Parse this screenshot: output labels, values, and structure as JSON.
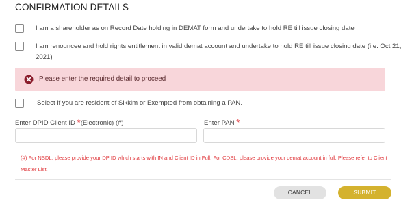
{
  "section": {
    "title": "CONFIRMATION DETAILS"
  },
  "checkboxes": [
    {
      "label": "I am a shareholder as on Record Date holding in DEMAT form and undertake to hold RE till issue closing date",
      "checked": false
    },
    {
      "label_line1": "I am renouncee and hold rights entitlement in valid demat account and undertake to hold RE till issue closing date (i.e. Oct 21,",
      "label_line2": "2021)",
      "checked": false
    },
    {
      "label": "Select if you are resident of Sikkim or Exempted from obtaining a PAN.",
      "checked": false
    }
  ],
  "alert": {
    "icon": "error-circle-icon",
    "message": "Please enter the required detail to proceed",
    "background": "#f8d6da",
    "icon_color": "#8b1d2c"
  },
  "fields": {
    "dpid": {
      "label": "Enter DPID Client ID ",
      "required_mark": "*",
      "suffix": "(Electronic) (#)",
      "value": ""
    },
    "pan": {
      "label": "Enter PAN ",
      "required_mark": "*",
      "value": ""
    }
  },
  "note": {
    "line1": "(#) For NSDL, please provide your DP ID which starts with IN and Client ID in Full. For CDSL, please provide your demat account in full. Please refer to Client",
    "line2": "Master List."
  },
  "buttons": {
    "cancel": "CANCEL",
    "submit": "SUBMIT",
    "submit_color": "#d4b22e"
  }
}
